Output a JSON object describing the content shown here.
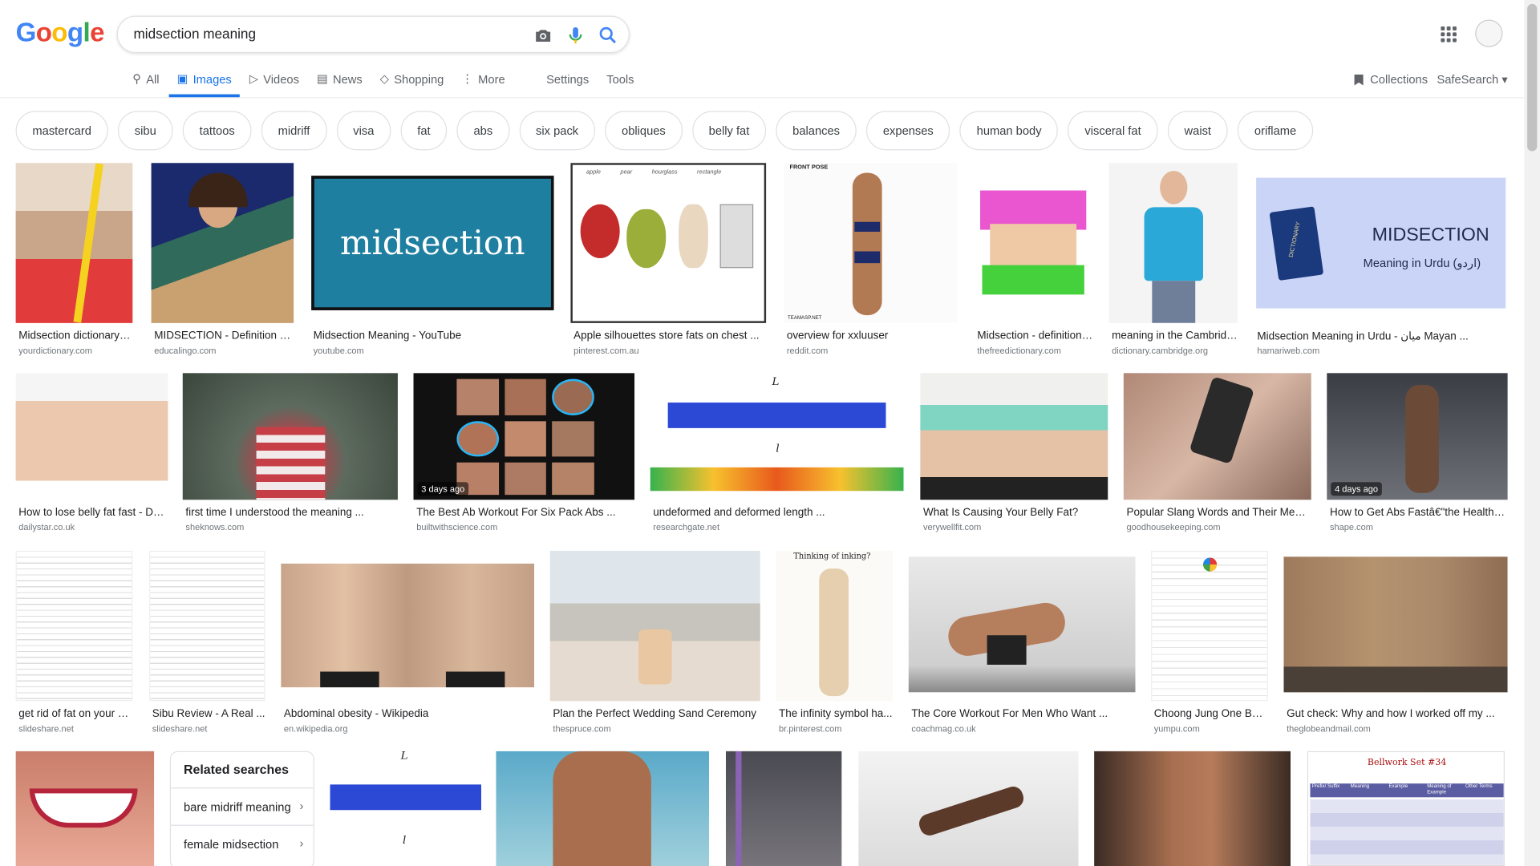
{
  "search": {
    "query": "midsection meaning"
  },
  "tabs": [
    {
      "label": "All",
      "icon": "search-icon"
    },
    {
      "label": "Images",
      "icon": "image-icon"
    },
    {
      "label": "Videos",
      "icon": "video-icon"
    },
    {
      "label": "News",
      "icon": "news-icon"
    },
    {
      "label": "Shopping",
      "icon": "tag-icon"
    },
    {
      "label": "More",
      "icon": "more-icon"
    },
    {
      "label": "Settings"
    },
    {
      "label": "Tools"
    }
  ],
  "header": {
    "collections": "Collections",
    "safesearch": "SafeSearch"
  },
  "chips": [
    "mastercard",
    "sibu",
    "tattoos",
    "midriff",
    "visa",
    "fat",
    "abs",
    "six pack",
    "obliques",
    "belly fat",
    "balances",
    "expenses",
    "human body",
    "visceral fat",
    "waist",
    "oriflame"
  ],
  "results": {
    "row1": [
      {
        "caption": "Midsection dictionary d...",
        "source": "yourdictionary.com"
      },
      {
        "caption": "MIDSECTION - Definition an...",
        "source": "educalingo.com"
      },
      {
        "caption": "Midsection Meaning - YouTube",
        "source": "youtube.com",
        "thumb_text": "midsection"
      },
      {
        "caption": "Apple silhouettes store fats on chest ...",
        "source": "pinterest.com.au",
        "thumb_labels": [
          "apple",
          "pear",
          "hourglass",
          "rectangle"
        ]
      },
      {
        "caption": "overview for xxluuser",
        "source": "reddit.com",
        "thumb_text": "FRONT POSE",
        "thumb_footer": "TEAMASP.NET"
      },
      {
        "caption": "Midsection - definition ...",
        "source": "thefreedictionary.com"
      },
      {
        "caption": "meaning in the Cambridg...",
        "source": "dictionary.cambridge.org"
      },
      {
        "caption": "Midsection Meaning in Urdu - میان Mayan ...",
        "source": "hamariweb.com",
        "thumb_title": "MIDSECTION",
        "thumb_sub": "Meaning in Urdu (اردو)",
        "thumb_book": "DICTIONARY"
      }
    ],
    "row2": [
      {
        "caption": "How to lose belly fat fast - Dail...",
        "source": "dailystar.co.uk"
      },
      {
        "caption": "first time I understood the meaning ...",
        "source": "sheknows.com"
      },
      {
        "caption": "The Best Ab Workout For Six Pack Abs ...",
        "source": "builtwithscience.com",
        "badge": "3 days ago"
      },
      {
        "caption": "undeformed and deformed length ...",
        "source": "researchgate.net",
        "thumb_L": "L",
        "thumb_l": "l"
      },
      {
        "caption": "What Is Causing Your Belly Fat?",
        "source": "verywellfit.com"
      },
      {
        "caption": "Popular Slang Words and Their Meani...",
        "source": "goodhousekeeping.com"
      },
      {
        "caption": "How to Get Abs Fastâ€\"the Healthy ...",
        "source": "shape.com",
        "badge": "4 days ago"
      }
    ],
    "row3": [
      {
        "caption": "get rid of fat on your m...",
        "source": "slideshare.net"
      },
      {
        "caption": "Sibu Review - A Real ...",
        "source": "slideshare.net"
      },
      {
        "caption": "Abdominal obesity - Wikipedia",
        "source": "en.wikipedia.org"
      },
      {
        "caption": "Plan the Perfect Wedding Sand Ceremony",
        "source": "thespruce.com"
      },
      {
        "caption": "The infinity symbol ha...",
        "source": "br.pinterest.com",
        "thumb_text": "Thinking of inking?"
      },
      {
        "caption": "The Core Workout For Men Who Want ...",
        "source": "coachmag.co.uk"
      },
      {
        "caption": "Choong Jung One Bas...",
        "source": "yumpu.com"
      },
      {
        "caption": "Gut check: Why and how I worked off my ...",
        "source": "theglobeandmail.com"
      }
    ],
    "row4": [
      {
        "thumb_L": "L",
        "thumb_l": "l"
      },
      {
        "thumb_title": "Bellwork Set #34",
        "thumb_headers": [
          "Prefix/ Suffix",
          "Meaning",
          "Example",
          "Meaning of Example",
          "Other Terms"
        ]
      }
    ]
  },
  "related": {
    "title": "Related searches",
    "items": [
      "bare midriff meaning",
      "female midsection"
    ]
  },
  "colors": {
    "accent": "#1a73e8",
    "chip_border": "#dfe1e5"
  }
}
